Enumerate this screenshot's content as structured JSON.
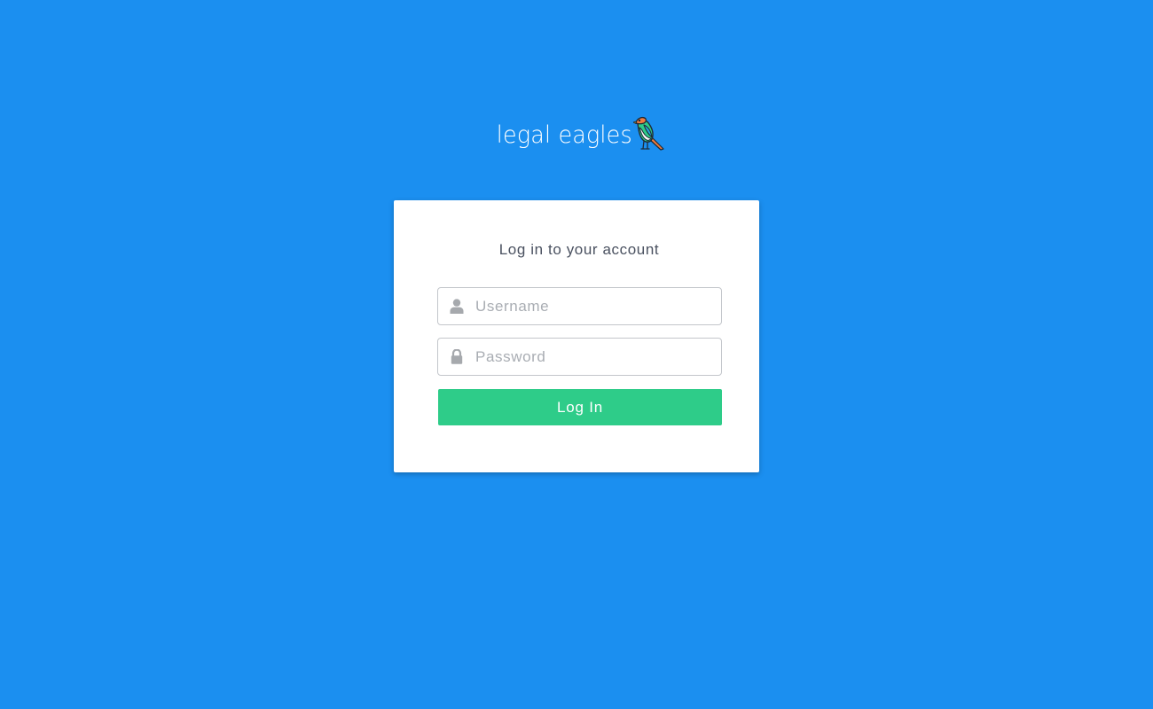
{
  "brand": {
    "logo_text": "legal eagles",
    "logo_icon": "eagle-bird-icon"
  },
  "login": {
    "title": "Log in to your account",
    "username": {
      "placeholder": "Username",
      "value": "",
      "icon": "user-icon"
    },
    "password": {
      "placeholder": "Password",
      "value": "",
      "icon": "lock-icon"
    },
    "submit_label": "Log In"
  },
  "colors": {
    "background": "#1b8ff0",
    "card": "#ffffff",
    "button": "#2ecc89",
    "title_text": "#4a5160",
    "placeholder": "#a9adb3",
    "icon": "#a6a9ad"
  }
}
